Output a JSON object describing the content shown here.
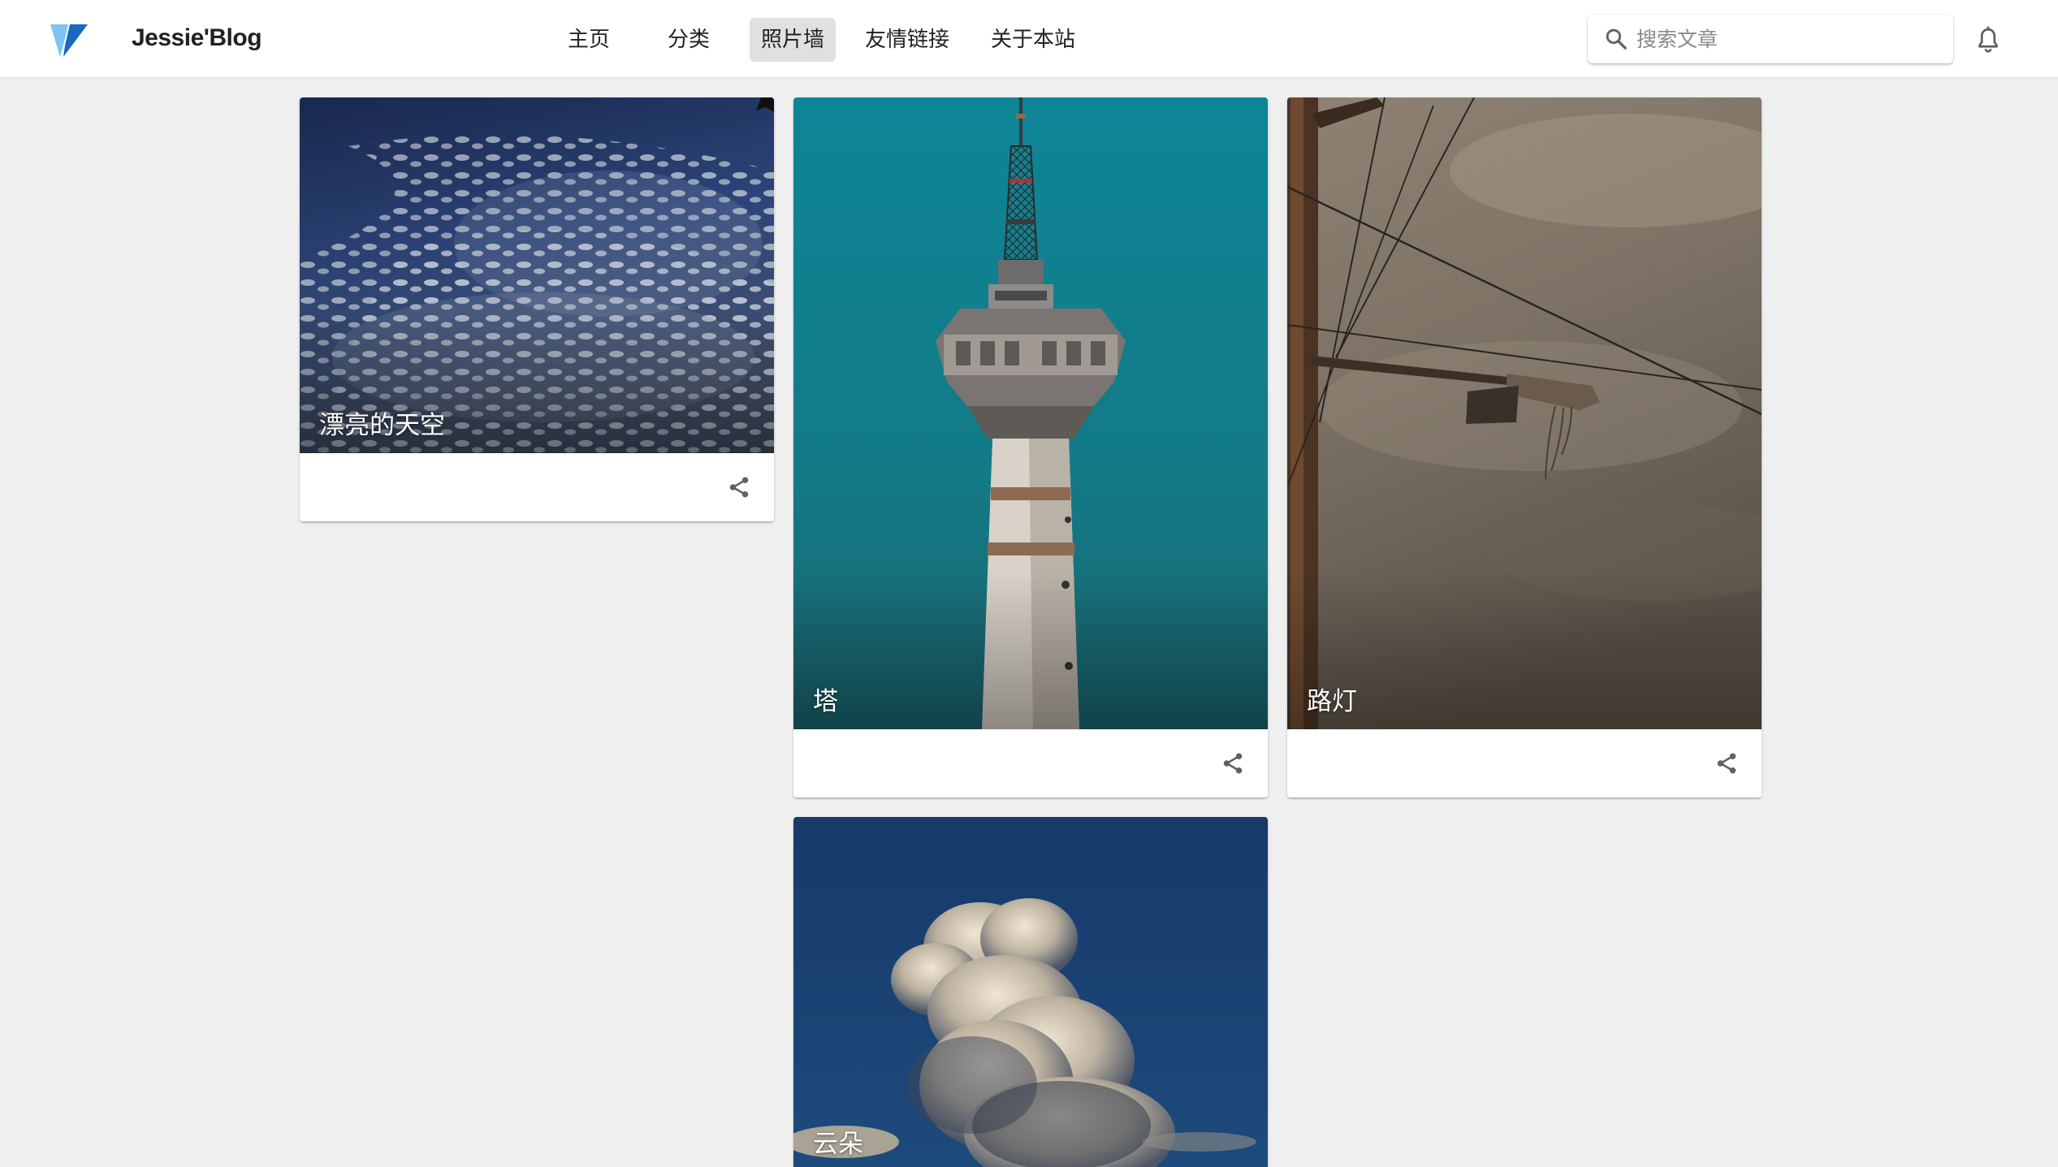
{
  "header": {
    "brand": "Jessie'Blog",
    "nav": [
      {
        "label": "主页",
        "active": false
      },
      {
        "label": "分类",
        "active": false
      },
      {
        "label": "照片墙",
        "active": true
      },
      {
        "label": "友情链接",
        "active": false
      },
      {
        "label": "关于本站",
        "active": false
      }
    ],
    "search_placeholder": "搜索文章",
    "search_value": "",
    "icons": [
      "vuetify-logo-icon",
      "search-icon",
      "bell-icon"
    ]
  },
  "photos": [
    {
      "caption": "漂亮的天空",
      "icon": "share-icon"
    },
    {
      "caption": "塔",
      "icon": "share-icon"
    },
    {
      "caption": "路灯",
      "icon": "share-icon"
    },
    {
      "caption": "云朵",
      "icon": "share-icon"
    }
  ],
  "colors": {
    "page_background": "#efefef",
    "appbar_background": "#ffffff",
    "active_nav_background": "#e0e0e0",
    "logo_light": "#7fc3f2",
    "logo_dark": "#1867c0"
  }
}
